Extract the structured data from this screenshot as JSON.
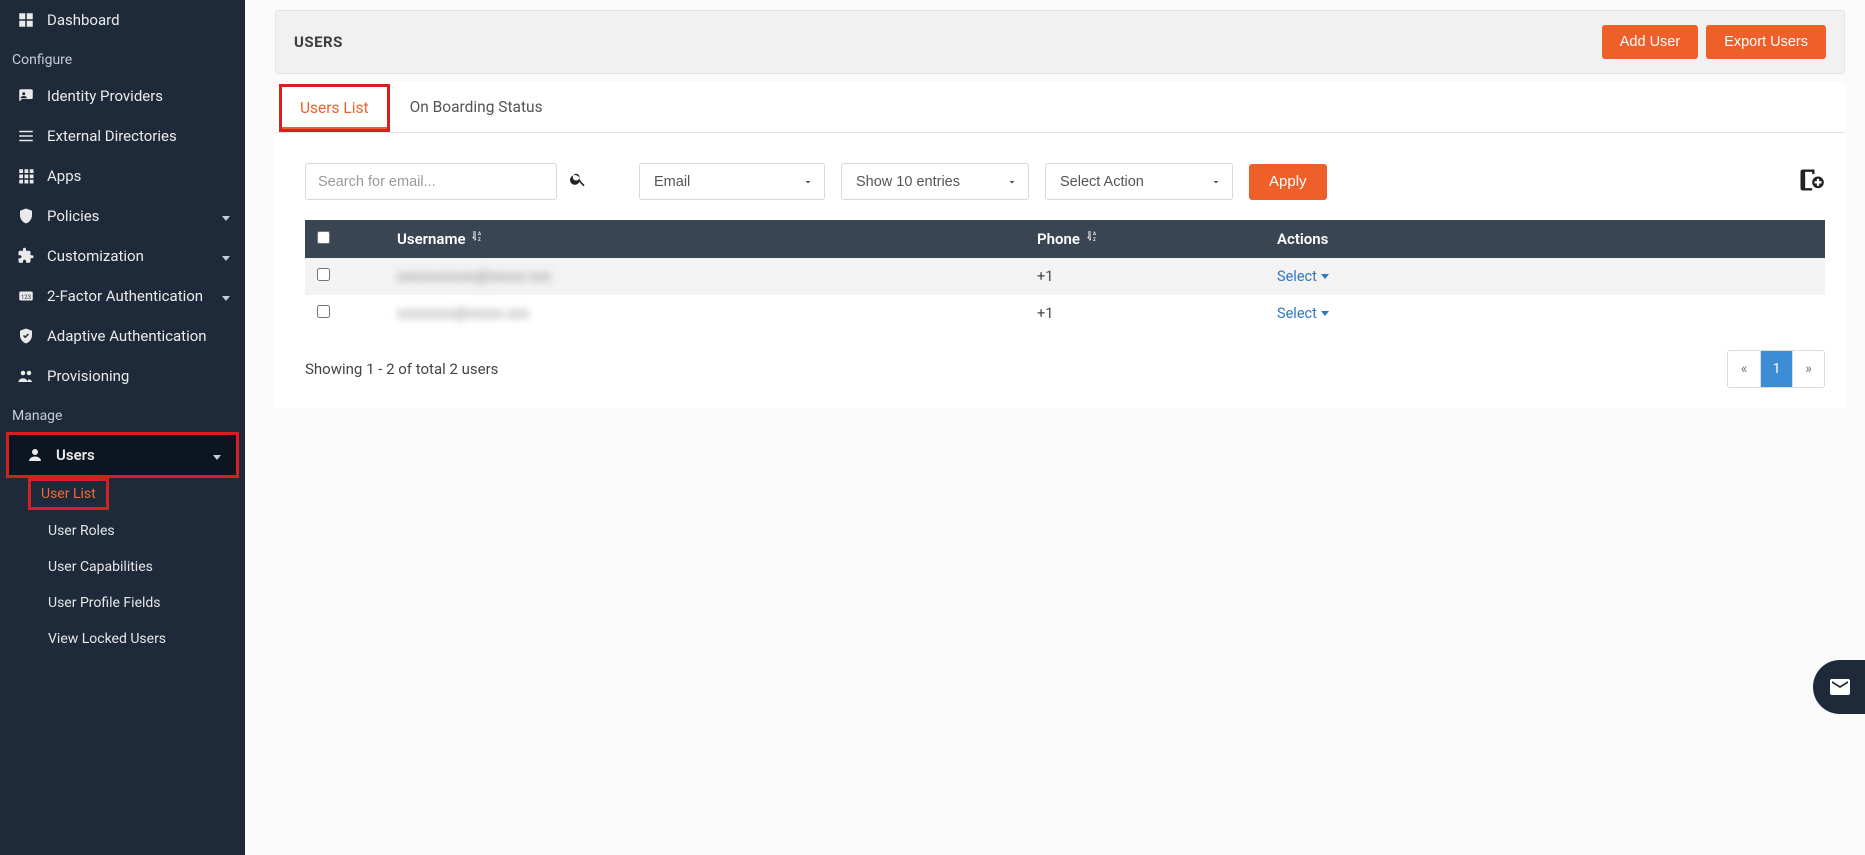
{
  "sidebar": {
    "items": {
      "dashboard": "Dashboard",
      "identity_providers": "Identity Providers",
      "external_directories": "External Directories",
      "apps": "Apps",
      "policies": "Policies",
      "customization": "Customization",
      "two_factor": "2-Factor Authentication",
      "adaptive_auth": "Adaptive Authentication",
      "provisioning": "Provisioning",
      "users": "Users"
    },
    "sections": {
      "configure": "Configure",
      "manage": "Manage"
    },
    "users_sub": {
      "user_list": "User List",
      "user_roles": "User Roles",
      "user_capabilities": "User Capabilities",
      "user_profile_fields": "User Profile Fields",
      "view_locked_users": "View Locked Users"
    }
  },
  "header": {
    "title": "USERS",
    "add_user": "Add User",
    "export_users": "Export Users"
  },
  "tabs": {
    "users_list": "Users List",
    "onboarding": "On Boarding Status"
  },
  "controls": {
    "search_placeholder": "Search for email...",
    "dd_email": "Email",
    "dd_entries": "Show 10 entries",
    "dd_action": "Select Action",
    "apply": "Apply"
  },
  "table": {
    "cols": {
      "username": "Username",
      "phone": "Phone",
      "actions": "Actions"
    },
    "rows": [
      {
        "username": "xxxxxxxxxxx@xxxxx.xxx",
        "phone": "+1",
        "action": "Select"
      },
      {
        "username": "xxxxxxxx@xxxxx.xxx",
        "phone": "+1",
        "action": "Select"
      }
    ],
    "showing": "Showing 1 - 2 of total 2 users"
  },
  "pagination": {
    "prev": "«",
    "page1": "1",
    "next": "»"
  }
}
